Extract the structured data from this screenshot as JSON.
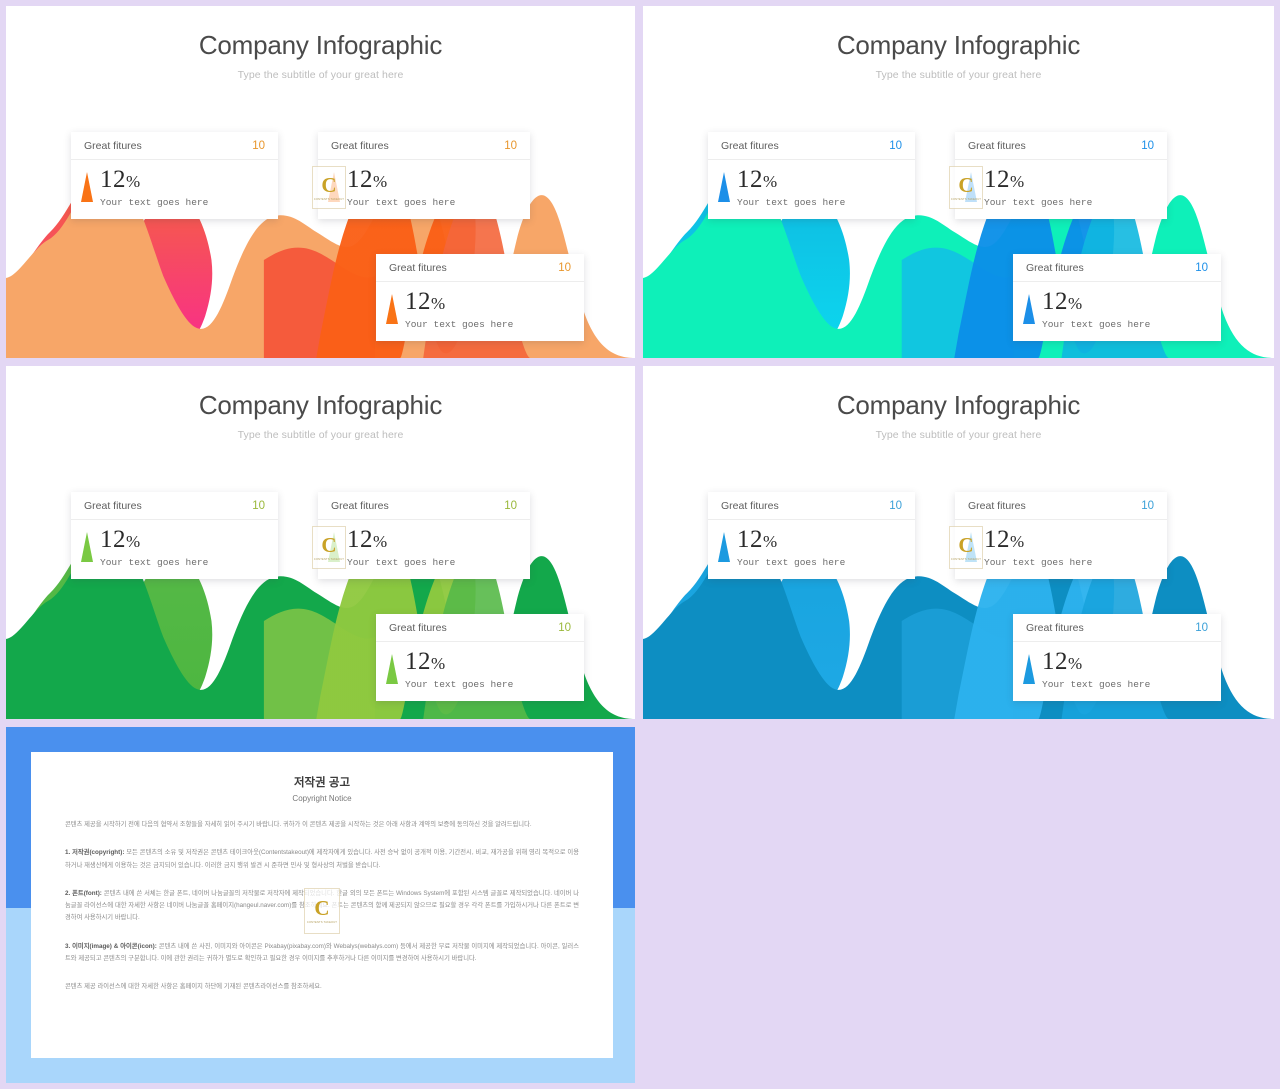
{
  "background_color": "#e3d7f4",
  "slides": [
    {
      "id": "slide-orange",
      "title": "Company Infographic",
      "subtitle": "Type the subtitle of your great here",
      "accent": "#f97316",
      "value_color": "#e8962c",
      "palette": {
        "base": "#f7a668",
        "mid": "#f4663b",
        "hot": "#f92a8f",
        "peak": "#fa5f16",
        "bump": "#f4563a"
      },
      "cards": [
        {
          "label": "Great fitures",
          "value": "10",
          "percent": "12",
          "symbol": "%",
          "sub": "Your text goes here"
        },
        {
          "label": "Great fitures",
          "value": "10",
          "percent": "12",
          "symbol": "%",
          "sub": "Your text goes here"
        },
        {
          "label": "Great fitures",
          "value": "10",
          "percent": "12",
          "symbol": "%",
          "sub": "Your text goes here"
        }
      ]
    },
    {
      "id": "slide-teal",
      "title": "Company Infographic",
      "subtitle": "Type the subtitle of your great here",
      "accent": "#1c8fe8",
      "value_color": "#1c8fe8",
      "palette": {
        "base": "#0ef0b9",
        "mid": "#0fb8e0",
        "hot": "#0cd9f0",
        "peak": "#0b8fe8",
        "bump": "#12c3e2"
      },
      "cards": [
        {
          "label": "Great fitures",
          "value": "10",
          "percent": "12",
          "symbol": "%",
          "sub": "Your text goes here"
        },
        {
          "label": "Great fitures",
          "value": "10",
          "percent": "12",
          "symbol": "%",
          "sub": "Your text goes here"
        },
        {
          "label": "Great fitures",
          "value": "10",
          "percent": "12",
          "symbol": "%",
          "sub": "Your text goes here"
        }
      ]
    },
    {
      "id": "slide-green",
      "title": "Company Infographic",
      "subtitle": "Type the subtitle of your great here",
      "accent": "#7ac943",
      "value_color": "#9ab83a",
      "palette": {
        "base": "#13a84b",
        "mid": "#57b948",
        "hot": "#4cb63f",
        "peak": "#8fc93f",
        "bump": "#76c247"
      },
      "cards": [
        {
          "label": "Great fitures",
          "value": "10",
          "percent": "12",
          "symbol": "%",
          "sub": "Your text goes here"
        },
        {
          "label": "Great fitures",
          "value": "10",
          "percent": "12",
          "symbol": "%",
          "sub": "Your text goes here"
        },
        {
          "label": "Great fitures",
          "value": "10",
          "percent": "12",
          "symbol": "%",
          "sub": "Your text goes here"
        }
      ]
    },
    {
      "id": "slide-blue",
      "title": "Company Infographic",
      "subtitle": "Type the subtitle of your great here",
      "accent": "#1c9ae0",
      "value_color": "#3aa0d8",
      "palette": {
        "base": "#0d8ec2",
        "mid": "#17a3dd",
        "hot": "#1fa9e6",
        "peak": "#2cb2ee",
        "bump": "#1b9ed6"
      },
      "cards": [
        {
          "label": "Great fitures",
          "value": "10",
          "percent": "12",
          "symbol": "%",
          "sub": "Your text goes here"
        },
        {
          "label": "Great fitures",
          "value": "10",
          "percent": "12",
          "symbol": "%",
          "sub": "Your text goes here"
        },
        {
          "label": "Great fitures",
          "value": "10",
          "percent": "12",
          "symbol": "%",
          "sub": "Your text goes here"
        }
      ]
    }
  ],
  "watermark": {
    "letter": "C",
    "caption": "CONTENTS TAKEOUT"
  },
  "copyright": {
    "title_ko": "저작권 공고",
    "title_en": "Copyright Notice",
    "intro": "콘텐츠 제공을 시작하기 전에 다음의 협약서 조항들을 자세히 읽어 주시기 바랍니다. 귀하가 이 콘텐츠 제공을 시작하는 것은 아래 사항과 계약의 보증에 동의하신 것을 알려드립니다.",
    "sections": [
      {
        "heading": "1. 저작권(copyright):",
        "body": " 모든 콘텐츠의 소유 및 저작권은 콘텐츠 테이크아웃(Contentstakeout)에 제작자에게 있습니다. 사전 승낙 없이 공개적 이용, 기간전시, 비교, 재가공을 위해 영리 목적으로 이용하거나 재생산에게 이용하는 것은 금지되어 있습니다. 이러한 금지 행위 발견 시 준하면 민사 및 형사상의 처벌을 받습니다."
      },
      {
        "heading": "2. 폰트(font):",
        "body": " 콘텐츠 내에 쓴 서체는 한글 폰트, 네이버 나눔글꼴의 저작물로 저작자에 제작되었습니다. 한글 외의 모든 폰트는 Windows System에 포함된 시스템 글꼴로 제작되었습니다. 네이버 나눔글꼴 라이선스에 대한 자세한 사항은 네이버 나눔글꼴 홈페이지(hangeul.naver.com)를 참조하세요. 폰트는 콘텐츠의 함께 제공되지 않으므로 필요할 경우 각각 폰트를 가입하시거나 다른 폰트로 변경하여 사용하시기 바랍니다."
      },
      {
        "heading": "3. 이미지(image) & 아이콘(icon):",
        "body": " 콘텐츠 내에 쓴 사진, 이미지와 아이콘은 Pixabay(pixabay.com)와 Webalys(webalys.com) 등에서 제공한 무료 저작물 이미지에 제작되었습니다. 아이콘, 일러스트와 제공되고 콘텐츠의 구분합니다. 이에 관한 권리는 귀하가 별도로 확인하고 필요한 경우 이미지를 추후하거나 다른 이미지를 변경하여 사용하시기 바랍니다."
      }
    ],
    "footer": "콘텐츠 제공 라이선스에 대한 자세한 사항은 홈페이지 하단에 기재된 콘텐츠라이선스를 참조하세요."
  }
}
